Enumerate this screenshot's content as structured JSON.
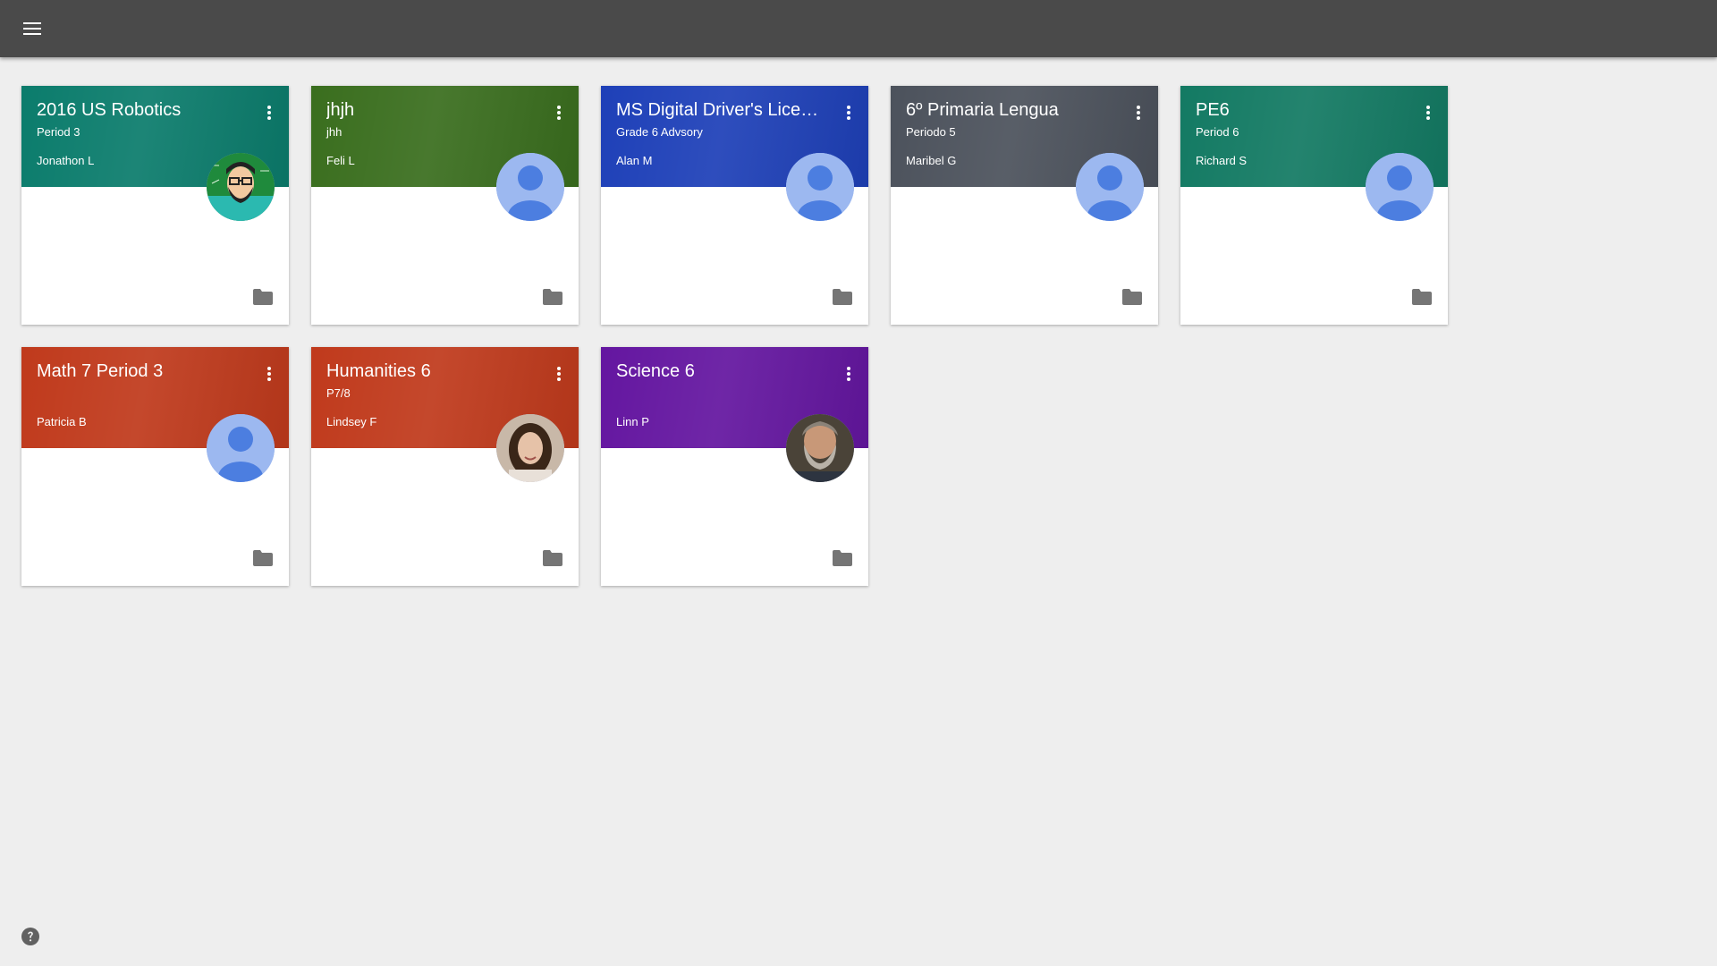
{
  "topbar": {
    "icon": "hamburger-menu-icon"
  },
  "help": {
    "icon": "help-circle-icon"
  },
  "colors": {
    "topbar": "#4a4a4a",
    "background": "#eeeeee",
    "default_avatar": "#9cb8f0",
    "default_avatar_figure": "#4c7ee0",
    "folder_icon": "#757575"
  },
  "classes": [
    {
      "title": "2016 US Robotics",
      "section": "Period 3",
      "teacher": "Jonathon L",
      "color": "#0b7c6c",
      "avatar": "cartoon"
    },
    {
      "title": "jhjh",
      "section": "jhh",
      "teacher": "Feli L",
      "color": "#3a6e1e",
      "avatar": "default"
    },
    {
      "title": "MS Digital Driver's License",
      "section": "Grade 6 Advsory",
      "teacher": "Alan M",
      "color": "#1e40b8",
      "avatar": "default"
    },
    {
      "title": "6º Primaria Lengua",
      "section": "Periodo 5",
      "teacher": "Maribel G",
      "color": "#4c525c",
      "avatar": "default"
    },
    {
      "title": "PE6",
      "section": "Period 6",
      "teacher": "Richard S",
      "color": "#137a63",
      "avatar": "default"
    },
    {
      "title": "Math 7 Period 3",
      "section": "",
      "teacher": "Patricia B",
      "color": "#c03a1c",
      "avatar": "default"
    },
    {
      "title": "Humanities 6",
      "section": "P7/8",
      "teacher": "Lindsey F",
      "color": "#c03a1c",
      "avatar": "photo-woman"
    },
    {
      "title": "Science 6",
      "section": "",
      "teacher": "Linn P",
      "color": "#6416a0",
      "avatar": "photo-man"
    }
  ]
}
